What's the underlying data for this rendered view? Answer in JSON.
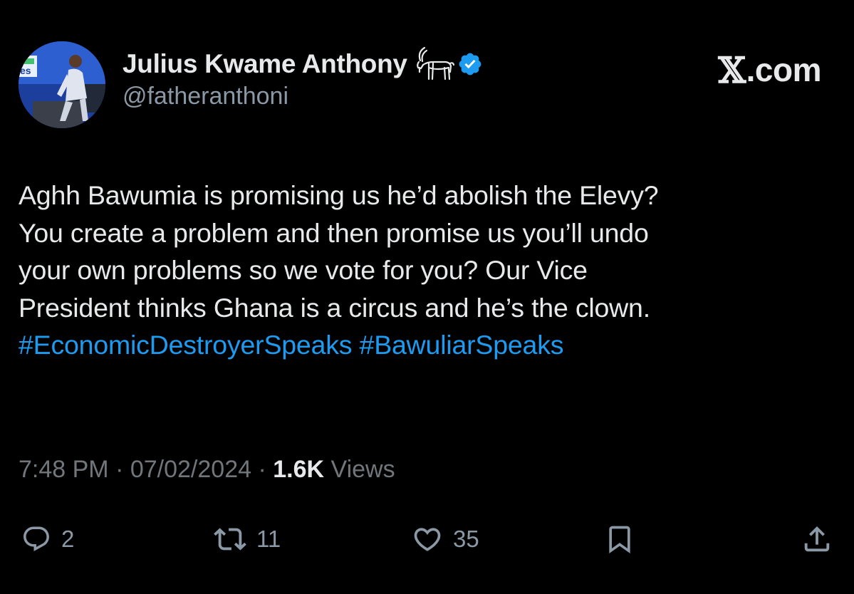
{
  "author": {
    "display_name": "Julius Kwame Anthony",
    "handle": "@fatheranthoni",
    "emoji_icon": "goat-emoji",
    "verified_icon": "verified-badge-icon",
    "verified_color": "#1d9bf0"
  },
  "brand": {
    "x_glyph": "𝕏",
    "suffix": ".com"
  },
  "tweet": {
    "lines": [
      "Aghh Bawumia is promising us he’d abolish the Elevy?",
      "You create a problem and then promise us you’ll undo",
      "your own problems so we vote for you? Our Vice",
      "President thinks Ghana is a circus and he’s the clown."
    ],
    "hashtags": [
      "#EconomicDestroyerSpeaks",
      "#BawuliarSpeaks"
    ]
  },
  "meta": {
    "time": "7:48 PM",
    "separator": " · ",
    "date": "07/02/2024",
    "views_count": "1.6K",
    "views_label": " Views"
  },
  "actions": {
    "reply_count": "2",
    "repost_count": "11",
    "like_count": "35"
  },
  "colors": {
    "background": "#000000",
    "text": "#e7e9ea",
    "secondary": "#71767b",
    "link": "#1d9bf0"
  }
}
